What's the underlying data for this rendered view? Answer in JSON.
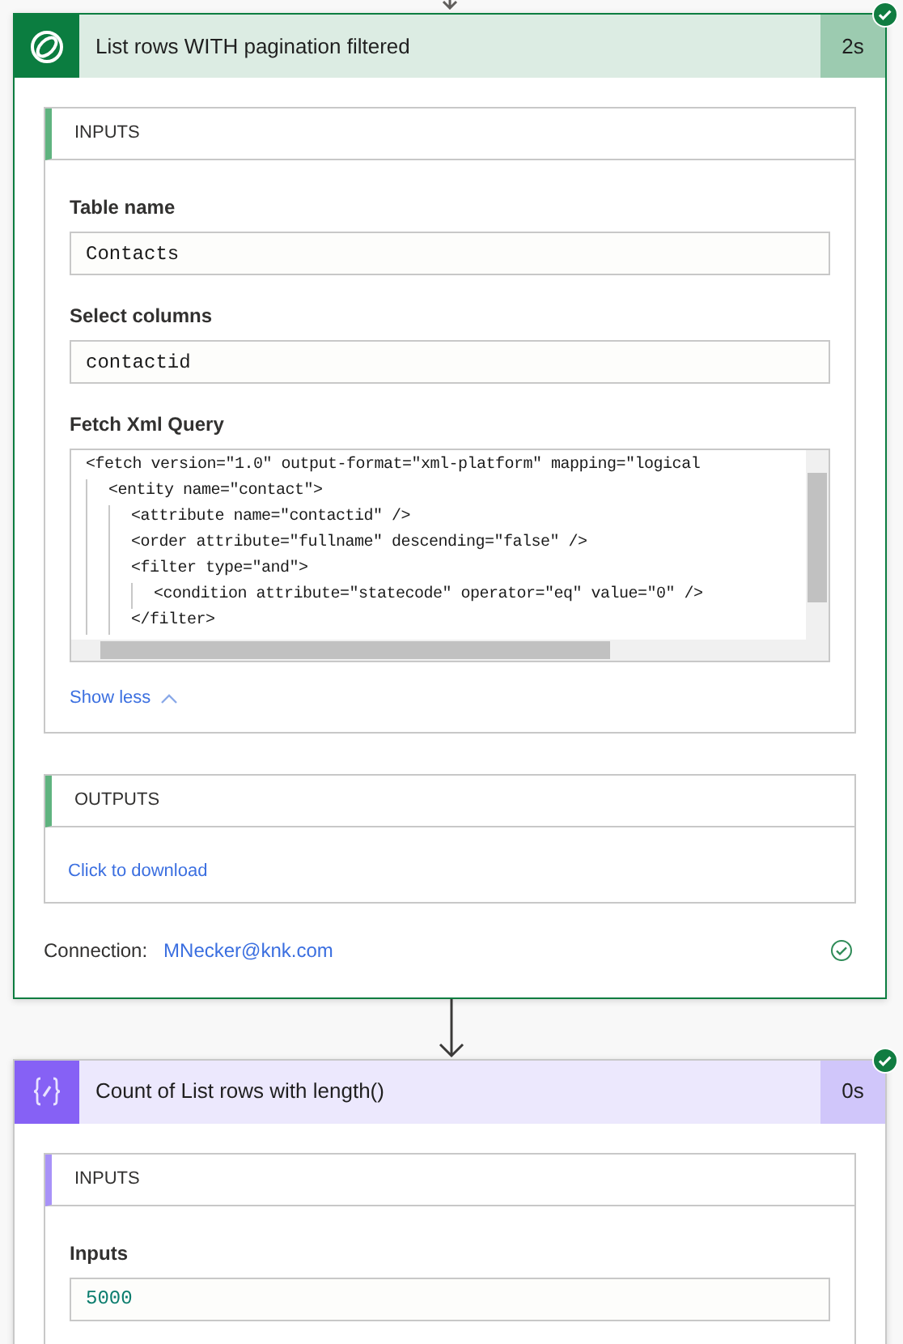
{
  "steps": [
    {
      "kind": "dataverse",
      "title": "List rows WITH pagination filtered",
      "duration": "2s",
      "succeeded": true,
      "inputs": {
        "heading": "INPUTS",
        "fields": [
          {
            "kind": "text",
            "label": "Table name",
            "value": "Contacts"
          },
          {
            "kind": "text",
            "label": "Select columns",
            "value": "contactid"
          },
          {
            "kind": "code",
            "label": "Fetch Xml Query",
            "lines": [
              {
                "text": "<fetch version=\"1.0\" output-format=\"xml-platform\" mapping=\"logical",
                "children": [
                  {
                    "text": "<entity name=\"contact\">",
                    "children": [
                      {
                        "text": "<attribute name=\"contactid\" />"
                      },
                      {
                        "text": "<order attribute=\"fullname\" descending=\"false\" />"
                      },
                      {
                        "text": "<filter type=\"and\">",
                        "children": [
                          {
                            "text": "<condition attribute=\"statecode\" operator=\"eq\" value=\"0\" />"
                          }
                        ]
                      },
                      {
                        "text": "</filter>"
                      }
                    ]
                  }
                ]
              }
            ]
          }
        ],
        "toggle": "Show less"
      },
      "outputs": {
        "heading": "OUTPUTS",
        "link": "Click to download"
      },
      "connection": {
        "label": "Connection:",
        "account": "MNecker@knk.com"
      }
    },
    {
      "kind": "compose",
      "title": "Count of List rows with length()",
      "duration": "0s",
      "succeeded": true,
      "inputs": {
        "heading": "INPUTS",
        "fields": [
          {
            "kind": "number",
            "label": "Inputs",
            "value": "5000"
          }
        ]
      }
    }
  ]
}
